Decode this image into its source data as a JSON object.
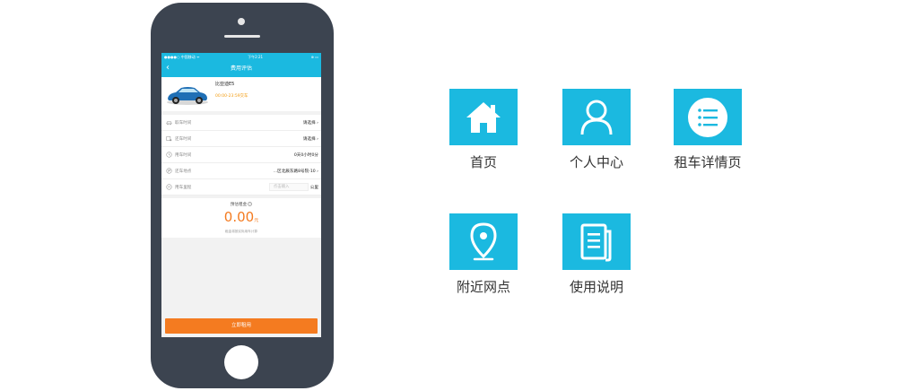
{
  "phone": {
    "status": {
      "carrier": "●●●●○ 中国移动 ᯤ",
      "time": "下午2:21",
      "battery": "⊕ ▭"
    },
    "nav": {
      "back": "‹",
      "title": "费用评估"
    },
    "car": {
      "name": "比亚迪E5",
      "hours": "00:00-23:59交车"
    },
    "rows": [
      {
        "label": "取车时间",
        "value": "请选择 ›",
        "icon": "pickup-car-icon"
      },
      {
        "label": "还车时间",
        "value": "请选择 ›",
        "icon": "return-car-icon"
      },
      {
        "label": "用车时间",
        "value": "0天0小时0分",
        "icon": "clock-icon"
      },
      {
        "label": "还车地点",
        "value": "...区北辰东路8号院-10 ›",
        "icon": "location-p-icon"
      },
      {
        "label": "用车里程",
        "placeholder": "点击输入",
        "unit": "公里",
        "icon": "mileage-icon"
      }
    ],
    "estimate": {
      "label": "预估租金",
      "amount": "0.00",
      "unit": "元",
      "note": "租金将按实际用车计算"
    },
    "rent_button": "立即租用"
  },
  "features": [
    {
      "label": "首页",
      "icon": "home-icon"
    },
    {
      "label": "个人中心",
      "icon": "user-icon"
    },
    {
      "label": "租车详情页",
      "icon": "list-icon"
    },
    {
      "label": "附近网点",
      "icon": "map-pin-icon"
    },
    {
      "label": "使用说明",
      "icon": "document-icon"
    }
  ],
  "colors": {
    "accent": "#1bb9e0",
    "orange": "#f47b20",
    "phone_body": "#3c4450"
  }
}
